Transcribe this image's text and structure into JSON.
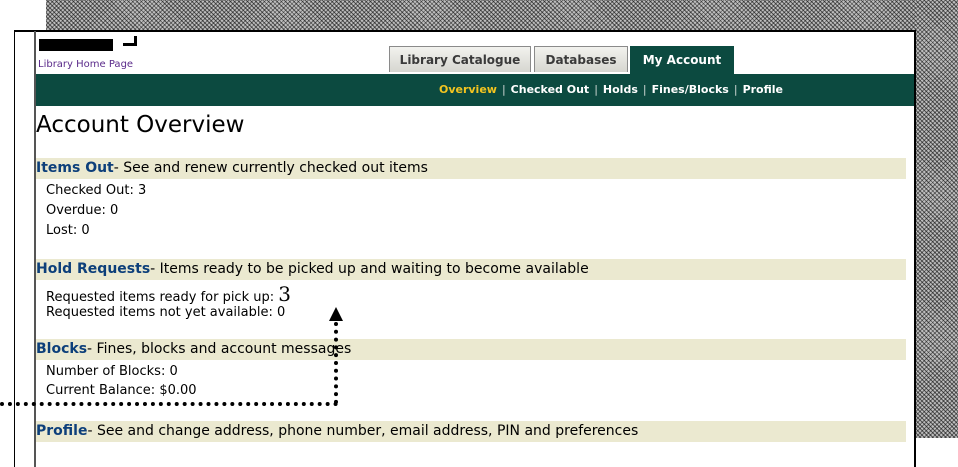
{
  "header": {
    "home_link": "Library Home Page"
  },
  "tabs": [
    {
      "label": "Library Catalogue",
      "active": false
    },
    {
      "label": "Databases",
      "active": false
    },
    {
      "label": "My Account",
      "active": true
    }
  ],
  "subnav": {
    "items": [
      "Overview",
      "Checked Out",
      "Holds",
      "Fines/Blocks",
      "Profile"
    ],
    "active": "Overview",
    "separator": "|"
  },
  "page_title": "Account Overview",
  "sections": {
    "items_out": {
      "title": "Items Out",
      "description": "- See and renew currently checked out items",
      "checked_out": "Checked Out: 3",
      "overdue": "Overdue: 0",
      "lost": "Lost: 0"
    },
    "hold_requests": {
      "title": "Hold Requests",
      "description": "- Items ready to be picked up and waiting to become available",
      "ready_label": "Requested items ready for pick up: ",
      "ready_value": "3",
      "not_available": "Requested items not yet available: 0"
    },
    "blocks": {
      "title": "Blocks",
      "description": "- Fines, blocks and account messages",
      "number_of_blocks": "Number of Blocks: 0",
      "current_balance": "Current Balance: $0.00"
    },
    "profile": {
      "title": "Profile",
      "description": "- See and change address, phone number, email address, PIN and preferences"
    }
  },
  "colors": {
    "nav_green": "#0c4a40",
    "active_subnav": "#f3c420",
    "section_title": "#0d3f7a",
    "section_bar": "#ebe9d0",
    "link_purple": "#5a2a8a"
  }
}
